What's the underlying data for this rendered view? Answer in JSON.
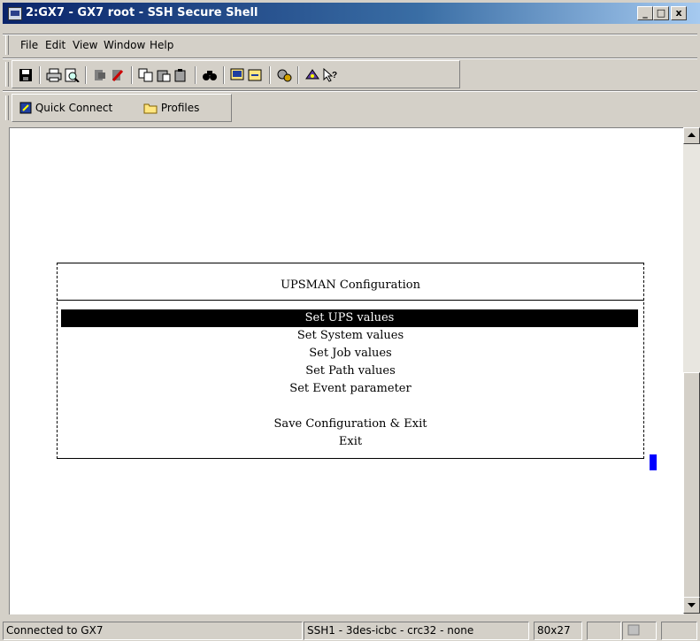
{
  "window": {
    "title": "2:GX7 - GX7 root - SSH Secure Shell",
    "controls": [
      "minimize",
      "maximize",
      "close"
    ],
    "close_glyph": "x",
    "icon": "ssh-app-icon"
  },
  "menu": {
    "items": [
      {
        "label": "File"
      },
      {
        "label": "Edit"
      },
      {
        "label": "View"
      },
      {
        "label": "Window"
      },
      {
        "label": "Help"
      }
    ]
  },
  "toolbar": {
    "icons": [
      "save-icon",
      "print-icon",
      "print-preview-icon",
      "disconnect-icon",
      "new-connection-icon",
      "copy-icon",
      "paste-icon",
      "paste-alt-icon",
      "find-icon",
      "new-terminal-icon",
      "file-transfer-icon",
      "settings-icon",
      "help-icon",
      "context-help-icon"
    ]
  },
  "quickbar": {
    "quick_connect": "Quick Connect",
    "profiles": "Profiles"
  },
  "terminal": {
    "dialog_title": "UPSMAN Configuration",
    "options": [
      {
        "label": "Set UPS values",
        "selected": true
      },
      {
        "label": "Set System values",
        "selected": false
      },
      {
        "label": "Set Job values",
        "selected": false
      },
      {
        "label": "Set Path values",
        "selected": false
      },
      {
        "label": "Set Event parameter",
        "selected": false
      },
      {
        "label": "Save Configuration & Exit",
        "selected": false
      },
      {
        "label": "Exit",
        "selected": false
      }
    ],
    "cursor_color": "#0000ff"
  },
  "status": {
    "connection": "Connected to GX7",
    "encryption": "SSH1 - 3des-icbc - crc32 - none",
    "size": "80x27"
  },
  "colors": {
    "titlebar_start": "#0a246a",
    "titlebar_end": "#a6caf0",
    "chrome": "#d4d0c8"
  }
}
